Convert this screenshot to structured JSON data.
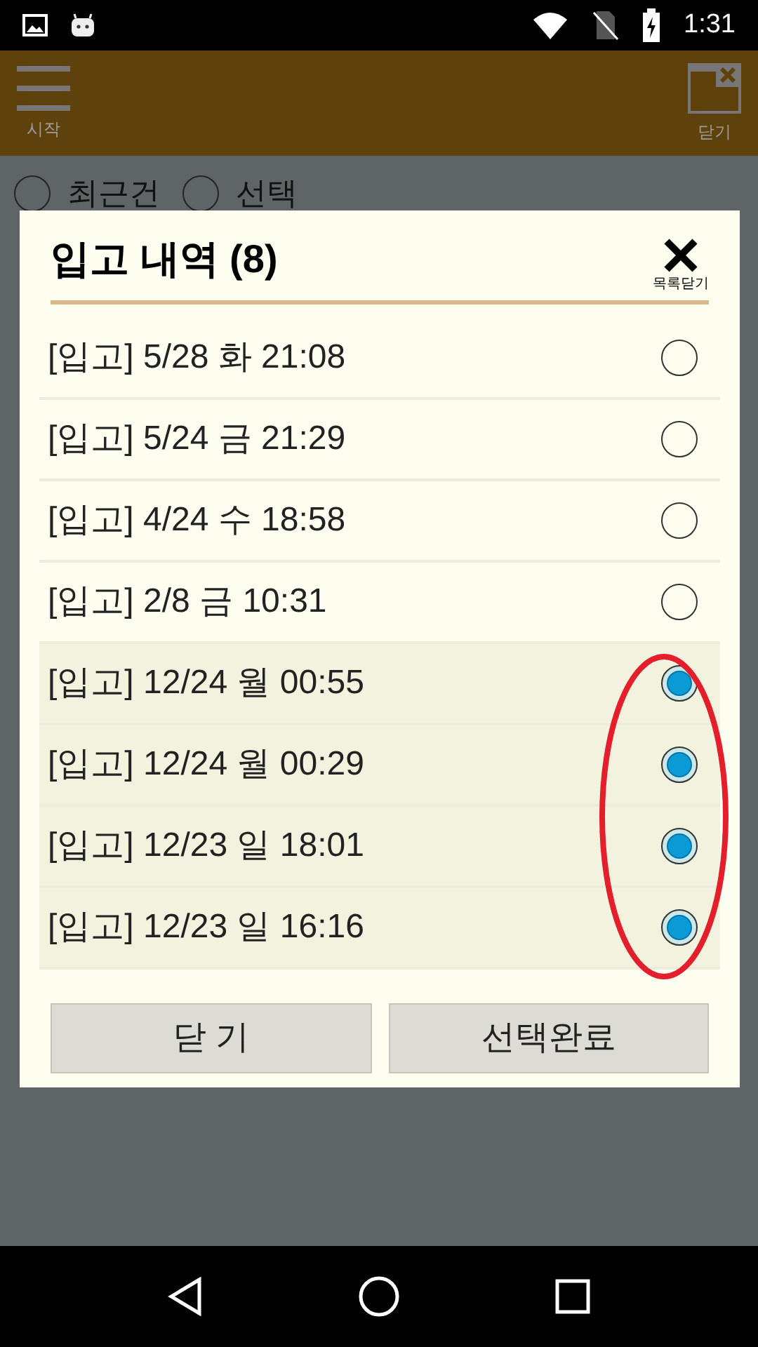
{
  "status_bar": {
    "time": "1:31"
  },
  "header": {
    "menu_label": "시작",
    "close_label": "닫기"
  },
  "filter_options": [
    {
      "label": "최근건",
      "selected": false
    },
    {
      "label": "선택",
      "selected": false
    }
  ],
  "dialog": {
    "title": "입고 내역 (8)",
    "close_label": "목록닫기",
    "items": [
      {
        "text": "[입고] 5/28 화 21:08",
        "selected": false
      },
      {
        "text": "[입고] 5/24 금 21:29",
        "selected": false
      },
      {
        "text": "[입고] 4/24 수 18:58",
        "selected": false
      },
      {
        "text": "[입고] 2/8 금 10:31",
        "selected": false
      },
      {
        "text": "[입고] 12/24 월 00:55",
        "selected": true
      },
      {
        "text": "[입고] 12/24 월 00:29",
        "selected": true
      },
      {
        "text": "[입고] 12/23 일 18:01",
        "selected": true
      },
      {
        "text": "[입고] 12/23 일 16:16",
        "selected": true
      }
    ],
    "buttons": [
      "닫 기",
      "선택완료"
    ]
  }
}
